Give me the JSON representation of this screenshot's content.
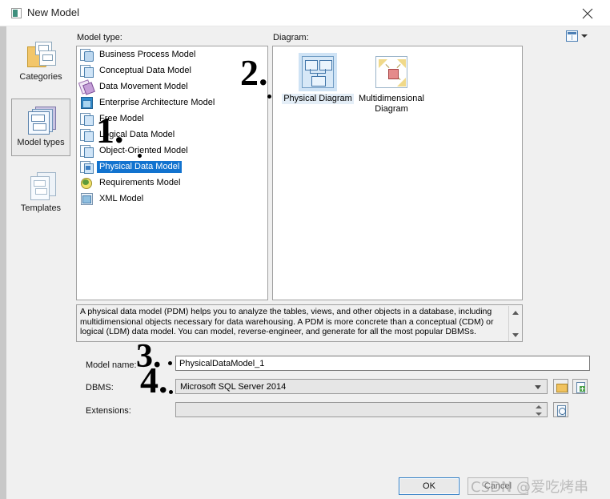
{
  "window": {
    "title": "New Model",
    "title_icon": "model-window-icon",
    "close_icon": "close-icon"
  },
  "sidebar": {
    "items": [
      {
        "label": "Categories",
        "icon": "categories-folder-icon",
        "selected": false
      },
      {
        "label": "Model types",
        "icon": "model-types-stack-icon",
        "selected": true
      },
      {
        "label": "Templates",
        "icon": "templates-pages-icon",
        "selected": false
      }
    ]
  },
  "main": {
    "model_type_label": "Model type:",
    "diagram_label": "Diagram:",
    "view_toggle_icon": "grid-view-icon",
    "view_toggle_chevron_icon": "chevron-down-icon"
  },
  "model_types": {
    "items": [
      {
        "label": "Business Process Model",
        "icon": "business-process-model-icon",
        "selected": false
      },
      {
        "label": "Conceptual Data Model",
        "icon": "conceptual-data-model-icon",
        "selected": false
      },
      {
        "label": "Data Movement Model",
        "icon": "data-movement-model-icon",
        "selected": false
      },
      {
        "label": "Enterprise Architecture Model",
        "icon": "enterprise-architecture-model-icon",
        "selected": false
      },
      {
        "label": "Free Model",
        "icon": "free-model-icon",
        "selected": false
      },
      {
        "label": "Logical Data Model",
        "icon": "logical-data-model-icon",
        "selected": false
      },
      {
        "label": "Object-Oriented Model",
        "icon": "object-oriented-model-icon",
        "selected": false
      },
      {
        "label": "Physical Data Model",
        "icon": "physical-data-model-icon",
        "selected": true
      },
      {
        "label": "Requirements Model",
        "icon": "requirements-model-icon",
        "selected": false
      },
      {
        "label": "XML Model",
        "icon": "xml-model-icon",
        "selected": false
      }
    ]
  },
  "diagrams": {
    "items": [
      {
        "label": "Physical Diagram",
        "icon": "physical-diagram-thumb",
        "selected": true
      },
      {
        "label": "Multidimensional Diagram",
        "icon": "multidimensional-diagram-thumb",
        "selected": false
      }
    ]
  },
  "description": {
    "text": "A physical data model (PDM) helps you to analyze the tables, views, and other objects in a database, including multidimensional objects necessary for data warehousing. A PDM is more concrete than a conceptual (CDM) or logical (LDM) data model. You can model, reverse-engineer, and generate for all the most popular DBMSs.",
    "scroll_up_icon": "scroll-up-arrow-icon",
    "scroll_down_icon": "scroll-down-arrow-icon"
  },
  "form": {
    "model_name_label": "Model name:",
    "model_name_value": "PhysicalDataModel_1",
    "model_name_placeholder": "",
    "dbms_label": "DBMS:",
    "dbms_value": "Microsoft SQL Server 2014",
    "dbms_folder_icon": "folder-open-icon",
    "dbms_new_icon": "new-document-icon",
    "extensions_label": "Extensions:",
    "extensions_value": "",
    "extensions_props_icon": "document-properties-icon"
  },
  "footer": {
    "ok_label": "OK",
    "cancel_label": "Cancel"
  },
  "annotations": [
    {
      "marker": "1.",
      "target": "model-type-list"
    },
    {
      "marker": "2.",
      "target": "physical-diagram"
    },
    {
      "marker": "3.",
      "target": "model-name-field"
    },
    {
      "marker": "4.",
      "target": "dbms-field"
    }
  ],
  "watermark": {
    "text": "CSDN @爱吃烤串"
  },
  "colors": {
    "selection_blue": "#1273cf",
    "dialog_bg": "#f0f0f0",
    "panel_bg": "#ffffff",
    "ok_border": "#2e7cc4"
  }
}
